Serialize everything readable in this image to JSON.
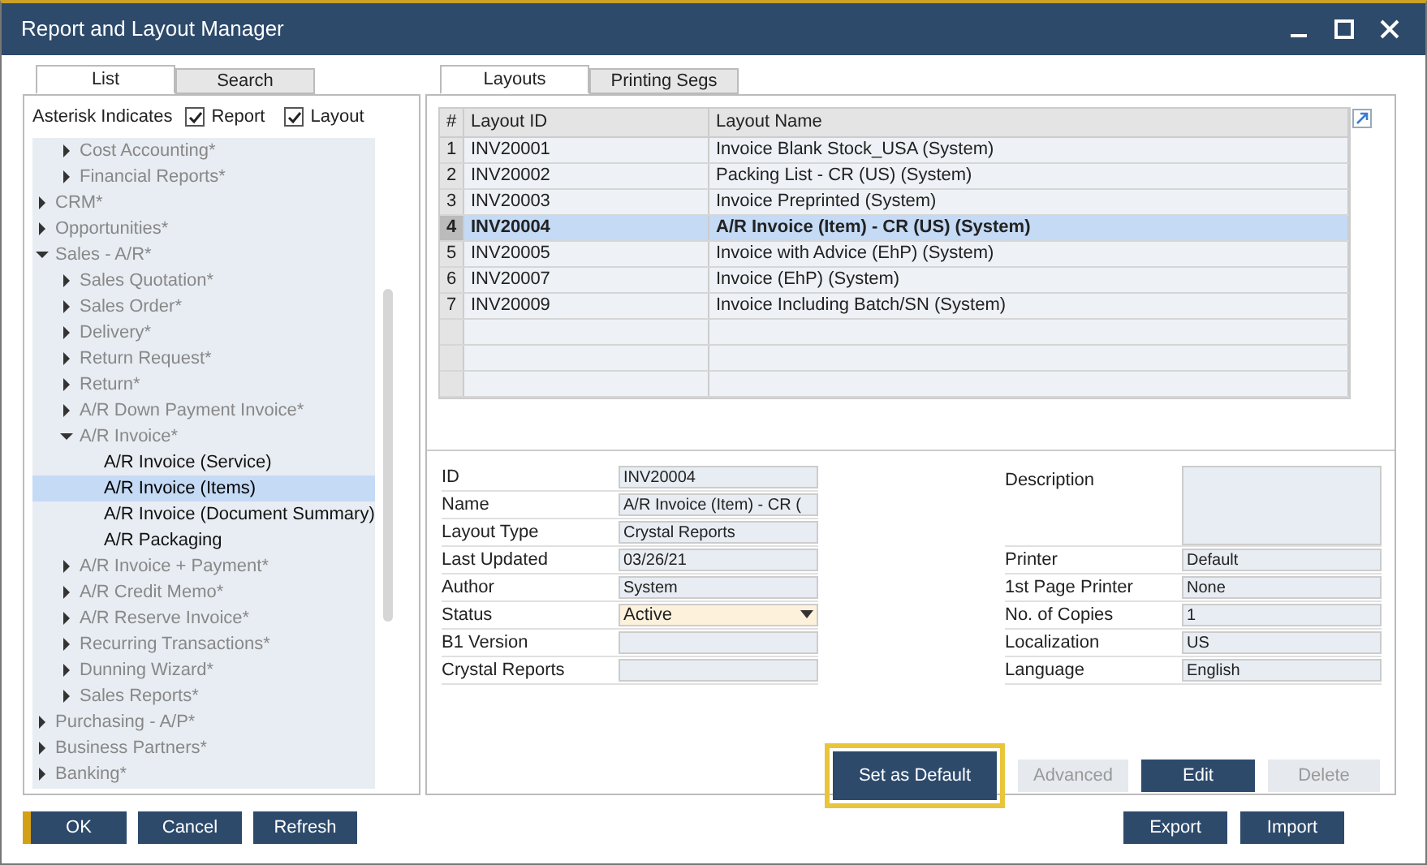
{
  "window": {
    "title": "Report and Layout Manager"
  },
  "left_tabs": [
    {
      "label": "List",
      "selected": true
    },
    {
      "label": "Search",
      "selected": false
    }
  ],
  "asterisk": {
    "label": "Asterisk Indicates",
    "checks": [
      {
        "label": "Report",
        "checked": true
      },
      {
        "label": "Layout",
        "checked": true
      }
    ]
  },
  "tree": [
    {
      "kind": "hidden",
      "children": [
        {
          "kind": "group",
          "label": "Cost Accounting*",
          "expanded": false,
          "selected": false
        },
        {
          "kind": "group",
          "label": "Financial Reports*",
          "expanded": false,
          "selected": false
        }
      ]
    },
    {
      "kind": "group",
      "label": "CRM*",
      "expanded": false,
      "selected": false
    },
    {
      "kind": "group",
      "label": "Opportunities*",
      "expanded": false,
      "selected": false
    },
    {
      "kind": "group",
      "label": "Sales - A/R*",
      "expanded": true,
      "selected": false,
      "children": [
        {
          "kind": "group",
          "label": "Sales Quotation*",
          "expanded": false,
          "selected": false
        },
        {
          "kind": "group",
          "label": "Sales Order*",
          "expanded": false,
          "selected": false
        },
        {
          "kind": "group",
          "label": "Delivery*",
          "expanded": false,
          "selected": false
        },
        {
          "kind": "group",
          "label": "Return Request*",
          "expanded": false,
          "selected": false
        },
        {
          "kind": "group",
          "label": "Return*",
          "expanded": false,
          "selected": false
        },
        {
          "kind": "group",
          "label": "A/R Down Payment Invoice*",
          "expanded": false,
          "selected": false
        },
        {
          "kind": "group",
          "label": "A/R Invoice*",
          "expanded": true,
          "selected": false,
          "children": [
            {
              "kind": "report",
              "label": "A/R Invoice (Service)",
              "selected": false
            },
            {
              "kind": "report",
              "label": "A/R Invoice (Items)",
              "selected": true
            },
            {
              "kind": "report",
              "label": "A/R Invoice (Document Summary)",
              "selected": false
            },
            {
              "kind": "report",
              "label": "A/R Packaging",
              "selected": false
            }
          ]
        },
        {
          "kind": "group",
          "label": "A/R Invoice + Payment*",
          "expanded": false,
          "selected": false
        },
        {
          "kind": "group",
          "label": "A/R Credit Memo*",
          "expanded": false,
          "selected": false
        },
        {
          "kind": "group",
          "label": "A/R Reserve Invoice*",
          "expanded": false,
          "selected": false
        },
        {
          "kind": "group",
          "label": "Recurring Transactions*",
          "expanded": false,
          "selected": false
        },
        {
          "kind": "group",
          "label": "Dunning Wizard*",
          "expanded": false,
          "selected": false
        },
        {
          "kind": "group",
          "label": "Sales Reports*",
          "expanded": false,
          "selected": false
        }
      ]
    },
    {
      "kind": "group",
      "label": "Purchasing - A/P*",
      "expanded": false,
      "selected": false
    },
    {
      "kind": "group",
      "label": "Business Partners*",
      "expanded": false,
      "selected": false
    },
    {
      "kind": "group",
      "label": "Banking*",
      "expanded": false,
      "selected": false
    }
  ],
  "left_buttons": [
    {
      "label": "OK",
      "default": true
    },
    {
      "label": "Cancel",
      "default": false
    },
    {
      "label": "Refresh",
      "default": false
    }
  ],
  "right_tabs": [
    {
      "label": "Layouts",
      "selected": true
    },
    {
      "label": "Printing Segs",
      "selected": false
    }
  ],
  "table": {
    "columns": [
      "#",
      "Layout ID",
      "Layout Name"
    ],
    "rows": [
      {
        "num": "1",
        "id": "INV20001",
        "name": "Invoice Blank Stock_USA (System)",
        "selected": false
      },
      {
        "num": "2",
        "id": "INV20002",
        "name": "Packing List - CR (US) (System)",
        "selected": false
      },
      {
        "num": "3",
        "id": "INV20003",
        "name": "Invoice Preprinted (System)",
        "selected": false
      },
      {
        "num": "4",
        "id": "INV20004",
        "name": "A/R Invoice (Item) - CR (US) (System)",
        "selected": true
      },
      {
        "num": "5",
        "id": "INV20005",
        "name": "Invoice with Advice (EhP) (System)",
        "selected": false
      },
      {
        "num": "6",
        "id": "INV20007",
        "name": "Invoice (EhP) (System)",
        "selected": false
      },
      {
        "num": "7",
        "id": "INV20009",
        "name": "Invoice Including Batch/SN (System)",
        "selected": false
      }
    ]
  },
  "details_left": [
    {
      "label": "ID",
      "kind": "text",
      "value": "INV20004"
    },
    {
      "label": "Name",
      "kind": "text",
      "value": "A/R Invoice (Item) - CR ("
    },
    {
      "label": "Layout Type",
      "kind": "text",
      "value": "Crystal Reports"
    },
    {
      "label": "Last Updated",
      "kind": "text",
      "value": "03/26/21"
    },
    {
      "label": "Author",
      "kind": "text",
      "value": "System"
    },
    {
      "label": "Status",
      "kind": "dropdown",
      "value": "Active"
    },
    {
      "label": "B1 Version",
      "kind": "text"
    },
    {
      "label": "Crystal Reports",
      "kind": "text"
    }
  ],
  "details_right": [
    {
      "label": "Description",
      "kind": "area"
    },
    {
      "label": "Printer",
      "kind": "text",
      "value": "Default"
    },
    {
      "label": "1st Page Printer",
      "kind": "text",
      "value": "None"
    },
    {
      "label": "No. of Copies",
      "kind": "text",
      "value": "1"
    },
    {
      "label": "Localization",
      "kind": "text",
      "value": "US"
    },
    {
      "label": "Language",
      "kind": "text",
      "value": "English"
    }
  ],
  "action_buttons": [
    {
      "label": "Set as Default",
      "disabled": false,
      "focused": true
    },
    {
      "label": "Advanced",
      "disabled": true,
      "focused": false
    },
    {
      "label": "Edit",
      "disabled": false,
      "focused": false
    },
    {
      "label": "Delete",
      "disabled": true,
      "focused": false
    }
  ],
  "bottom_buttons": [
    "Export",
    "Import"
  ]
}
